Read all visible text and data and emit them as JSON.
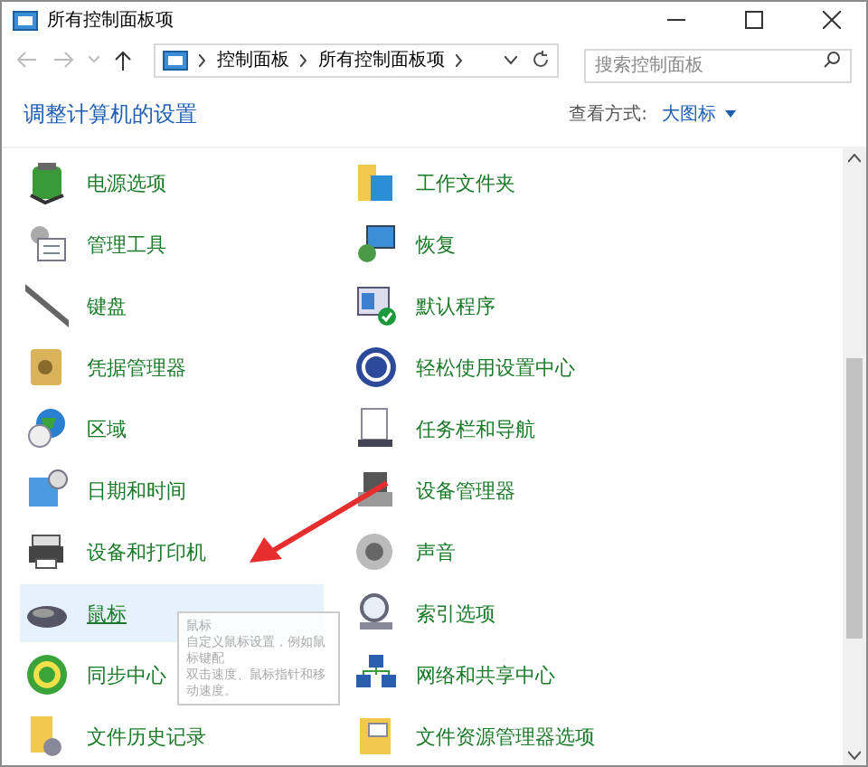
{
  "window": {
    "title": "所有控制面板项"
  },
  "address_bar": {
    "path": [
      "控制面板",
      "所有控制面板项"
    ]
  },
  "search": {
    "placeholder": "搜索控制面板"
  },
  "heading": "调整计算机的设置",
  "view_by": {
    "label": "查看方式:",
    "value": "大图标"
  },
  "items": [
    {
      "label": "电源选项",
      "selected": false
    },
    {
      "label": "工作文件夹",
      "selected": false
    },
    {
      "label": "管理工具",
      "selected": false
    },
    {
      "label": "恢复",
      "selected": false
    },
    {
      "label": "键盘",
      "selected": false
    },
    {
      "label": "默认程序",
      "selected": false
    },
    {
      "label": "凭据管理器",
      "selected": false
    },
    {
      "label": "轻松使用设置中心",
      "selected": false
    },
    {
      "label": "区域",
      "selected": false
    },
    {
      "label": "任务栏和导航",
      "selected": false
    },
    {
      "label": "日期和时间",
      "selected": false
    },
    {
      "label": "设备管理器",
      "selected": false
    },
    {
      "label": "设备和打印机",
      "selected": false
    },
    {
      "label": "声音",
      "selected": false
    },
    {
      "label": "鼠标",
      "selected": true
    },
    {
      "label": "索引选项",
      "selected": false
    },
    {
      "label": "同步中心",
      "selected": false
    },
    {
      "label": "网络和共享中心",
      "selected": false
    },
    {
      "label": "文件历史记录",
      "selected": false
    },
    {
      "label": "文件资源管理器选项",
      "selected": false
    }
  ],
  "tooltip": {
    "title": "鼠标",
    "lines": [
      "自定义鼠标设置，例如鼠标键配",
      "双击速度、鼠标指针和移动速度。"
    ]
  }
}
